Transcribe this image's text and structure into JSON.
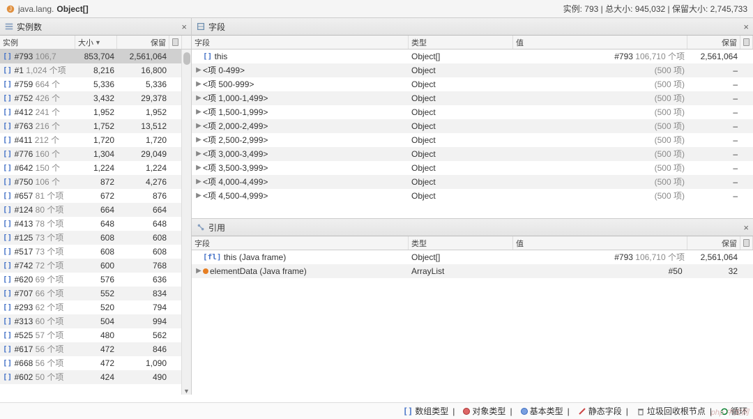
{
  "header": {
    "icon": "java-icon",
    "title_prefix": "java.lang.",
    "title_bold": "Object[]",
    "stats": "实例: 793  |  总大小: 945,032  |  保留大小: 2,745,733"
  },
  "left_panel": {
    "title": "实例数",
    "columns": {
      "c0": "实例",
      "c1": "大小",
      "c1_sort": "▼",
      "c2": "保留",
      "cfg": ""
    },
    "rows": [
      {
        "id": "#793",
        "note": "106,7",
        "size": "853,704",
        "retained": "2,561,064",
        "selected": true
      },
      {
        "id": "#1",
        "note": "1,024 个项",
        "size": "8,216",
        "retained": "16,800"
      },
      {
        "id": "#759",
        "note": "664 个",
        "size": "5,336",
        "retained": "5,336"
      },
      {
        "id": "#752",
        "note": "426 个",
        "size": "3,432",
        "retained": "29,378"
      },
      {
        "id": "#412",
        "note": "241 个",
        "size": "1,952",
        "retained": "1,952"
      },
      {
        "id": "#763",
        "note": "216 个",
        "size": "1,752",
        "retained": "13,512"
      },
      {
        "id": "#411",
        "note": "212 个",
        "size": "1,720",
        "retained": "1,720"
      },
      {
        "id": "#776",
        "note": "160 个",
        "size": "1,304",
        "retained": "29,049"
      },
      {
        "id": "#642",
        "note": "150 个",
        "size": "1,224",
        "retained": "1,224"
      },
      {
        "id": "#750",
        "note": "106 个",
        "size": "872",
        "retained": "4,276"
      },
      {
        "id": "#657",
        "note": "81 个项",
        "size": "672",
        "retained": "876"
      },
      {
        "id": "#124",
        "note": "80 个项",
        "size": "664",
        "retained": "664"
      },
      {
        "id": "#413",
        "note": "78 个项",
        "size": "648",
        "retained": "648"
      },
      {
        "id": "#125",
        "note": "73 个项",
        "size": "608",
        "retained": "608"
      },
      {
        "id": "#517",
        "note": "73 个项",
        "size": "608",
        "retained": "608"
      },
      {
        "id": "#742",
        "note": "72 个项",
        "size": "600",
        "retained": "768"
      },
      {
        "id": "#620",
        "note": "69 个项",
        "size": "576",
        "retained": "636"
      },
      {
        "id": "#707",
        "note": "66 个项",
        "size": "552",
        "retained": "834"
      },
      {
        "id": "#293",
        "note": "62 个项",
        "size": "520",
        "retained": "794"
      },
      {
        "id": "#313",
        "note": "60 个项",
        "size": "504",
        "retained": "994"
      },
      {
        "id": "#525",
        "note": "57 个项",
        "size": "480",
        "retained": "562"
      },
      {
        "id": "#617",
        "note": "56 个项",
        "size": "472",
        "retained": "846"
      },
      {
        "id": "#668",
        "note": "56 个项",
        "size": "472",
        "retained": "1,090"
      },
      {
        "id": "#602",
        "note": "50 个项",
        "size": "424",
        "retained": "490"
      }
    ]
  },
  "fields_panel": {
    "title": "字段",
    "columns": {
      "c0": "字段",
      "c1": "类型",
      "c2": "值",
      "c3": "保留",
      "cfg": ""
    },
    "rows": [
      {
        "expand": "",
        "icon": "brackets",
        "field": "this",
        "type": "Object[]",
        "value_id": "#793",
        "value_note": "106,710 个项",
        "retained": "2,561,064"
      },
      {
        "expand": "▶",
        "icon": "",
        "field": "<项 0-499>",
        "type": "Object",
        "value_id": "",
        "value_note": "(500 项)",
        "retained": "–"
      },
      {
        "expand": "▶",
        "icon": "",
        "field": "<项 500-999>",
        "type": "Object",
        "value_id": "",
        "value_note": "(500 项)",
        "retained": "–"
      },
      {
        "expand": "▶",
        "icon": "",
        "field": "<项 1,000-1,499>",
        "type": "Object",
        "value_id": "",
        "value_note": "(500 项)",
        "retained": "–"
      },
      {
        "expand": "▶",
        "icon": "",
        "field": "<项 1,500-1,999>",
        "type": "Object",
        "value_id": "",
        "value_note": "(500 项)",
        "retained": "–"
      },
      {
        "expand": "▶",
        "icon": "",
        "field": "<项 2,000-2,499>",
        "type": "Object",
        "value_id": "",
        "value_note": "(500 项)",
        "retained": "–"
      },
      {
        "expand": "▶",
        "icon": "",
        "field": "<项 2,500-2,999>",
        "type": "Object",
        "value_id": "",
        "value_note": "(500 项)",
        "retained": "–"
      },
      {
        "expand": "▶",
        "icon": "",
        "field": "<项 3,000-3,499>",
        "type": "Object",
        "value_id": "",
        "value_note": "(500 项)",
        "retained": "–"
      },
      {
        "expand": "▶",
        "icon": "",
        "field": "<项 3,500-3,999>",
        "type": "Object",
        "value_id": "",
        "value_note": "(500 项)",
        "retained": "–"
      },
      {
        "expand": "▶",
        "icon": "",
        "field": "<项 4,000-4,499>",
        "type": "Object",
        "value_id": "",
        "value_note": "(500 项)",
        "retained": "–"
      },
      {
        "expand": "▶",
        "icon": "",
        "field": "<项 4,500-4,999>",
        "type": "Object",
        "value_id": "",
        "value_note": "(500 项)",
        "retained": "–"
      }
    ]
  },
  "refs_panel": {
    "title": "引用",
    "columns": {
      "c0": "字段",
      "c1": "类型",
      "c2": "值",
      "c3": "保留",
      "cfg": ""
    },
    "rows": [
      {
        "expand": "",
        "icon": "frame-brackets",
        "field": "this (Java frame)",
        "type": "Object[]",
        "value_id": "#793",
        "value_note": "106,710 个项",
        "retained": "2,561,064"
      },
      {
        "expand": "▶",
        "icon": "orange-dot",
        "field": "elementData (Java frame)",
        "type": "ArrayList",
        "value_id": "#50",
        "value_note": "",
        "retained": "32"
      }
    ]
  },
  "footer": {
    "arr": "数组类型",
    "obj": "对象类型",
    "prim": "基本类型",
    "static": "静态字段",
    "gc": "垃圾回收根节点",
    "loop": "循环"
  },
  "watermark": "php 中文网"
}
